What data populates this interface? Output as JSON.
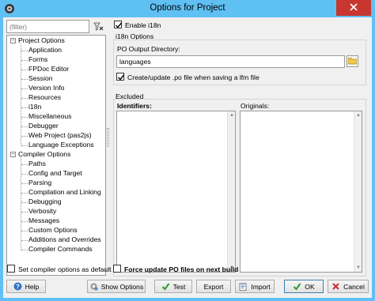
{
  "window": {
    "title": "Options for Project"
  },
  "filter": {
    "placeholder": "(filter)"
  },
  "tree": {
    "items": [
      {
        "label": "Project Options",
        "level": 0,
        "expanded": true
      },
      {
        "label": "Application",
        "level": 1
      },
      {
        "label": "Forms",
        "level": 1
      },
      {
        "label": "FPDoc Editor",
        "level": 1
      },
      {
        "label": "Session",
        "level": 1
      },
      {
        "label": "Version Info",
        "level": 1
      },
      {
        "label": "Resources",
        "level": 1
      },
      {
        "label": "i18n",
        "level": 1,
        "selected": true
      },
      {
        "label": "Miscellaneous",
        "level": 1
      },
      {
        "label": "Debugger",
        "level": 1
      },
      {
        "label": "Web Project (pas2js)",
        "level": 1
      },
      {
        "label": "Language Exceptions",
        "level": 1
      },
      {
        "label": "Compiler Options",
        "level": 0,
        "expanded": true
      },
      {
        "label": "Paths",
        "level": 1
      },
      {
        "label": "Config and Target",
        "level": 1
      },
      {
        "label": "Parsing",
        "level": 1
      },
      {
        "label": "Compilation and Linking",
        "level": 1
      },
      {
        "label": "Debugging",
        "level": 1
      },
      {
        "label": "Verbosity",
        "level": 1
      },
      {
        "label": "Messages",
        "level": 1
      },
      {
        "label": "Custom Options",
        "level": 1
      },
      {
        "label": "Additions and Overrides",
        "level": 1
      },
      {
        "label": "Compiler Commands",
        "level": 1
      }
    ]
  },
  "i18n": {
    "enable_label": "Enable i18n",
    "enable_checked": true,
    "group_title": "i18n Options",
    "po_dir_label": "PO Output Directory:",
    "po_dir_value": "languages",
    "create_update_label": "Create/update .po file when saving a lfm file",
    "create_update_checked": true
  },
  "excluded": {
    "group_title": "Excluded",
    "identifiers_label": "Identifiers:",
    "originals_label": "Originals:"
  },
  "bottom": {
    "set_default_label": "Set compiler options as default",
    "set_default_checked": false,
    "force_update_label": "Force update PO files on next build",
    "force_update_checked": false
  },
  "buttons": {
    "help": "Help",
    "show_options": "Show Options",
    "test": "Test",
    "export": "Export",
    "import": "Import",
    "ok": "OK",
    "cancel": "Cancel"
  },
  "colors": {
    "titlebar": "#5fc0f3",
    "close": "#c7372f",
    "ok_icon": "#2e9a2e",
    "cancel_icon": "#d12b2b",
    "help_icon": "#2f6fc4"
  },
  "icons": {
    "app": "lazarus-icon",
    "close": "close-icon",
    "filter_clear": "clear-filter-icon",
    "directory": "folder-icon",
    "help": "help-icon",
    "show_options": "show-options-icon",
    "test": "test-check-icon",
    "import": "import-icon",
    "ok": "ok-check-icon",
    "cancel": "cancel-x-icon"
  }
}
